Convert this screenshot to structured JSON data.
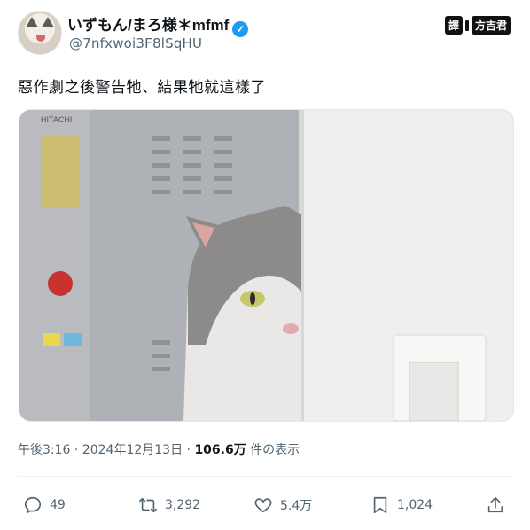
{
  "author": {
    "display_name": "いずもん/まろ様＊mfmf",
    "handle": "@7nfxwoi3F8lSqHU"
  },
  "watermark": {
    "left": "譯",
    "right": "方吉君"
  },
  "tweet": {
    "text": "惡作劇之後警告牠、結果牠就這樣了"
  },
  "photo": {
    "appliance_brand": "HITACHI"
  },
  "meta": {
    "time": "午後3:16",
    "sep1": "·",
    "date": "2024年12月13日",
    "sep2": "·",
    "views": "106.6万",
    "views_label": "件の表示"
  },
  "actions": {
    "replies": "49",
    "reposts": "3,292",
    "likes": "5.4万",
    "bookmarks": "1,024"
  },
  "colors": {
    "accent": "#1d9bf0",
    "text_secondary": "#536471",
    "text_primary": "#0f1419"
  }
}
